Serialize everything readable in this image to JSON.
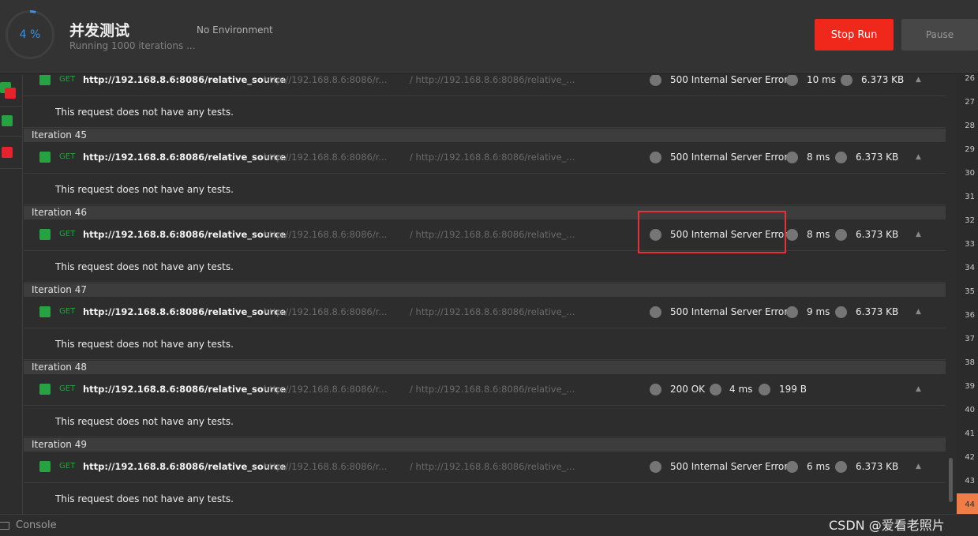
{
  "run": {
    "progress_text": "4 %",
    "progress_fraction": 0.04,
    "title": "并发测试",
    "subtitle": "Running 1000 iterations ...",
    "environment": "No Environment",
    "stop_label": "Stop Run",
    "pause_label": "Pause",
    "accent_color": "#3a8fe0",
    "stop_color": "#f0281b"
  },
  "left_status": [
    "green-red",
    "green",
    "red"
  ],
  "iterations": [
    {
      "label": "",
      "method": "GET",
      "url": "http://192.168.8.6:8086/relative_source",
      "url_short": "http://192.168.8.6:8086/r...",
      "url_path": "/ http://192.168.8.6:8086/relative_...",
      "status": "500 Internal Server Error",
      "time": "10 ms",
      "size": "6.373 KB",
      "test_message": "This request does not have any tests."
    },
    {
      "label": "Iteration 45",
      "method": "GET",
      "url": "http://192.168.8.6:8086/relative_source",
      "url_short": "http://192.168.8.6:8086/r...",
      "url_path": "/ http://192.168.8.6:8086/relative_...",
      "status": "500 Internal Server Error",
      "time": "8 ms",
      "size": "6.373 KB",
      "test_message": "This request does not have any tests."
    },
    {
      "label": "Iteration 46",
      "method": "GET",
      "url": "http://192.168.8.6:8086/relative_source",
      "url_short": "http://192.168.8.6:8086/r...",
      "url_path": "/ http://192.168.8.6:8086/relative_...",
      "status": "500 Internal Server Error",
      "time": "8 ms",
      "size": "6.373 KB",
      "test_message": "This request does not have any tests."
    },
    {
      "label": "Iteration 47",
      "method": "GET",
      "url": "http://192.168.8.6:8086/relative_source",
      "url_short": "http://192.168.8.6:8086/r...",
      "url_path": "/ http://192.168.8.6:8086/relative_...",
      "status": "500 Internal Server Error",
      "time": "9 ms",
      "size": "6.373 KB",
      "test_message": "This request does not have any tests."
    },
    {
      "label": "Iteration 48",
      "method": "GET",
      "url": "http://192.168.8.6:8086/relative_source",
      "url_short": "http://192.168.8.6:8086/r...",
      "url_path": "/ http://192.168.8.6:8086/relative_...",
      "status": "200 OK",
      "time": "4 ms",
      "size": "199 B",
      "test_message": "This request does not have any tests."
    },
    {
      "label": "Iteration 49",
      "method": "GET",
      "url": "http://192.168.8.6:8086/relative_source",
      "url_short": "http://192.168.8.6:8086/r...",
      "url_path": "/ http://192.168.8.6:8086/relative_...",
      "status": "500 Internal Server Error",
      "time": "6 ms",
      "size": "6.373 KB",
      "test_message": "This request does not have any tests."
    }
  ],
  "iteration_numbers": [
    "26",
    "27",
    "28",
    "29",
    "30",
    "31",
    "32",
    "33",
    "34",
    "35",
    "36",
    "37",
    "38",
    "39",
    "40",
    "41",
    "42",
    "43",
    "44"
  ],
  "active_iteration": "44",
  "footer": {
    "console_label": "Console",
    "watermark": "CSDN @爱看老照片"
  }
}
